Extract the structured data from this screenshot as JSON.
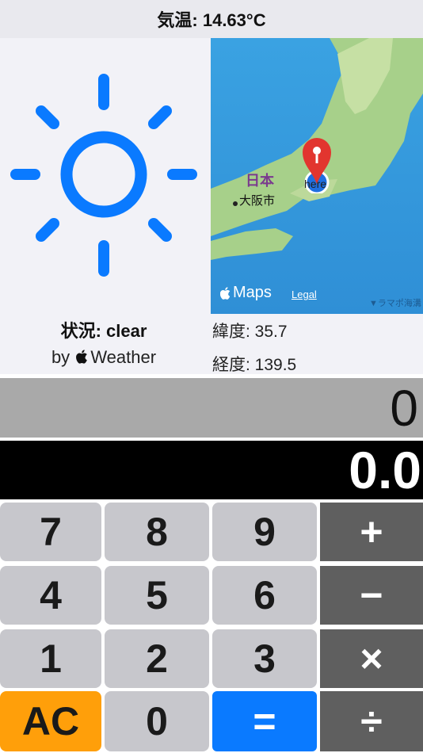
{
  "header": {
    "temperature": "気温: 14.63°C"
  },
  "weather": {
    "icon": "sun-icon",
    "condition": "状況: clear",
    "by_prefix": "by",
    "by_service": "Weather",
    "accent_color": "#0a7aff"
  },
  "map": {
    "brand": "Maps",
    "legal": "Legal",
    "labels": {
      "country": "日本",
      "city": "大阪市",
      "pin": "here",
      "corner": "▼ラマポ海溝"
    }
  },
  "coords": {
    "latitude": "緯度: 35.7",
    "longitude": "経度: 139.5"
  },
  "calculator": {
    "secondary_display": "0",
    "main_display": "0.0",
    "keys": {
      "seven": "7",
      "eight": "8",
      "nine": "9",
      "plus": "+",
      "four": "4",
      "five": "5",
      "six": "6",
      "minus": "−",
      "one": "1",
      "two": "2",
      "three": "3",
      "multiply": "×",
      "ac": "AC",
      "zero": "0",
      "equals": "=",
      "divide": "÷"
    },
    "colors": {
      "number": "#c7c7cc",
      "operator": "#5f5f5f",
      "ac": "#ff9f0a",
      "equals": "#0a7aff"
    }
  }
}
